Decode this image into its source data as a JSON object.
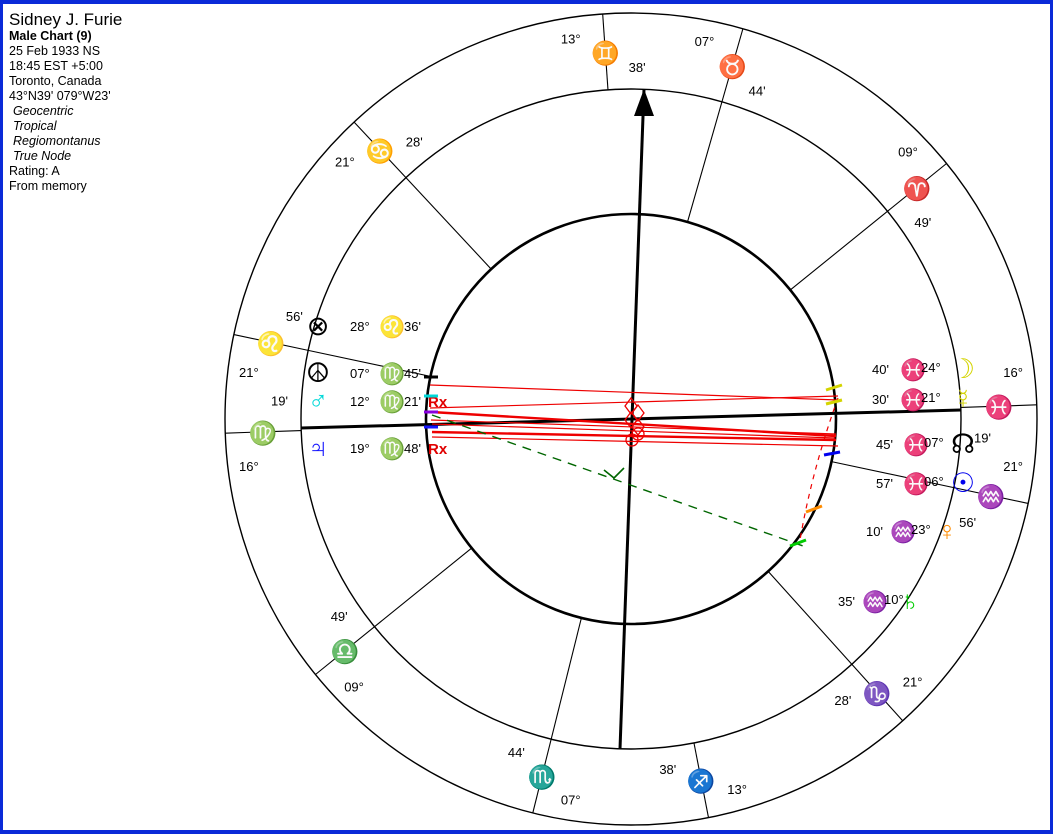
{
  "info": {
    "name": "Sidney J. Furie",
    "chart_type": "Male Chart (9)",
    "date": "25 Feb 1933 NS",
    "time": "18:45  EST +5:00",
    "place": "Toronto, Canada",
    "coords": "43°N39' 079°W23'",
    "system_1": "Geocentric",
    "system_2": "Tropical",
    "system_3": "Regiomontanus",
    "system_4": "True Node",
    "rating": "Rating: A",
    "source": "From memory"
  },
  "colors": {
    "aries": "#ff0000",
    "taurus": "#ff8c00",
    "gemini": "#e8e800",
    "cancer": "#33dd00",
    "leo": "#00dd00",
    "virgo": "#00e878",
    "libra": "#00e8e8",
    "scorpio": "#1560ff",
    "sagittarius": "#1515ff",
    "capricorn": "#8800dd",
    "aquarius": "#ee22ee",
    "pisces": "#ff1493",
    "moon": "#d4d400",
    "mercury": "#d4d400",
    "venus": "#ff8c00",
    "mars": "#00d8d8",
    "jupiter": "#1515ff",
    "saturn": "#00cc00",
    "sun": "#0000ee",
    "node": "#000000",
    "fortune": "#000000",
    "aspect_red": "#ee0000",
    "aspect_green": "#006600",
    "ring": "#000000"
  },
  "cusps": [
    {
      "name": "mc",
      "deg": "13°",
      "sign": "gemini",
      "glyph": "♊",
      "min": "38'"
    },
    {
      "name": "c11",
      "deg": "21°",
      "sign": "cancer",
      "glyph": "♋",
      "min": "28'"
    },
    {
      "name": "c12",
      "deg": "21°",
      "sign": "leo",
      "glyph": "♌",
      "min": "56'"
    },
    {
      "name": "asc",
      "deg": "16°",
      "sign": "virgo",
      "glyph": "♍",
      "min": "19'"
    },
    {
      "name": "c2",
      "deg": "09°",
      "sign": "libra",
      "glyph": "♎",
      "min": "49'"
    },
    {
      "name": "c3",
      "deg": "07°",
      "sign": "scorpio",
      "glyph": "♏",
      "min": "44'"
    },
    {
      "name": "ic",
      "deg": "13°",
      "sign": "sagittarius",
      "glyph": "♐",
      "min": "38'"
    },
    {
      "name": "c5",
      "deg": "21°",
      "sign": "capricorn",
      "glyph": "♑",
      "min": "28'"
    },
    {
      "name": "c6",
      "deg": "21°",
      "sign": "aquarius",
      "glyph": "♒",
      "min": "56'"
    },
    {
      "name": "dsc",
      "deg": "16°",
      "sign": "pisces",
      "glyph": "♓",
      "min": "19'"
    },
    {
      "name": "c8",
      "deg": "09°",
      "sign": "aries",
      "glyph": "♈",
      "min": "49'"
    },
    {
      "name": "c9",
      "deg": "07°",
      "sign": "taurus",
      "glyph": "♉",
      "min": "44'"
    }
  ],
  "planets_left": [
    {
      "name": "fortune",
      "glyph": "⊗",
      "deg": "28°",
      "sign": "leo",
      "sign_glyph": "♌",
      "min": "36'",
      "rx": ""
    },
    {
      "name": "south-node",
      "glyph": "☮",
      "deg": "07°",
      "sign": "virgo",
      "sign_glyph": "♍",
      "min": "45'",
      "rx": ""
    },
    {
      "name": "mars",
      "glyph": "♂",
      "deg": "12°",
      "sign": "virgo",
      "sign_glyph": "♍",
      "min": "21'",
      "rx": "Rx"
    },
    {
      "name": "jupiter",
      "glyph": "♃",
      "deg": "19°",
      "sign": "virgo",
      "sign_glyph": "♍",
      "min": "48'",
      "rx": "Rx"
    }
  ],
  "planets_right": [
    {
      "name": "moon",
      "glyph": "☽",
      "deg": "24°",
      "sign": "pisces",
      "sign_glyph": "♓",
      "min": "40'"
    },
    {
      "name": "mercury",
      "glyph": "☿",
      "deg": "21°",
      "sign": "pisces",
      "sign_glyph": "♓",
      "min": "30'"
    },
    {
      "name": "north-node",
      "glyph": "☊",
      "deg": "07°",
      "sign": "pisces",
      "sign_glyph": "♓",
      "min": "45'"
    },
    {
      "name": "sun",
      "glyph": "☉",
      "deg": "06°",
      "sign": "pisces",
      "sign_glyph": "♓",
      "min": "57'"
    },
    {
      "name": "venus",
      "glyph": "♀",
      "deg": "23°",
      "sign": "aquarius",
      "sign_glyph": "♒",
      "min": "10'"
    },
    {
      "name": "saturn",
      "glyph": "♄",
      "deg": "10°",
      "sign": "aquarius",
      "sign_glyph": "♒",
      "min": "35'"
    }
  ]
}
